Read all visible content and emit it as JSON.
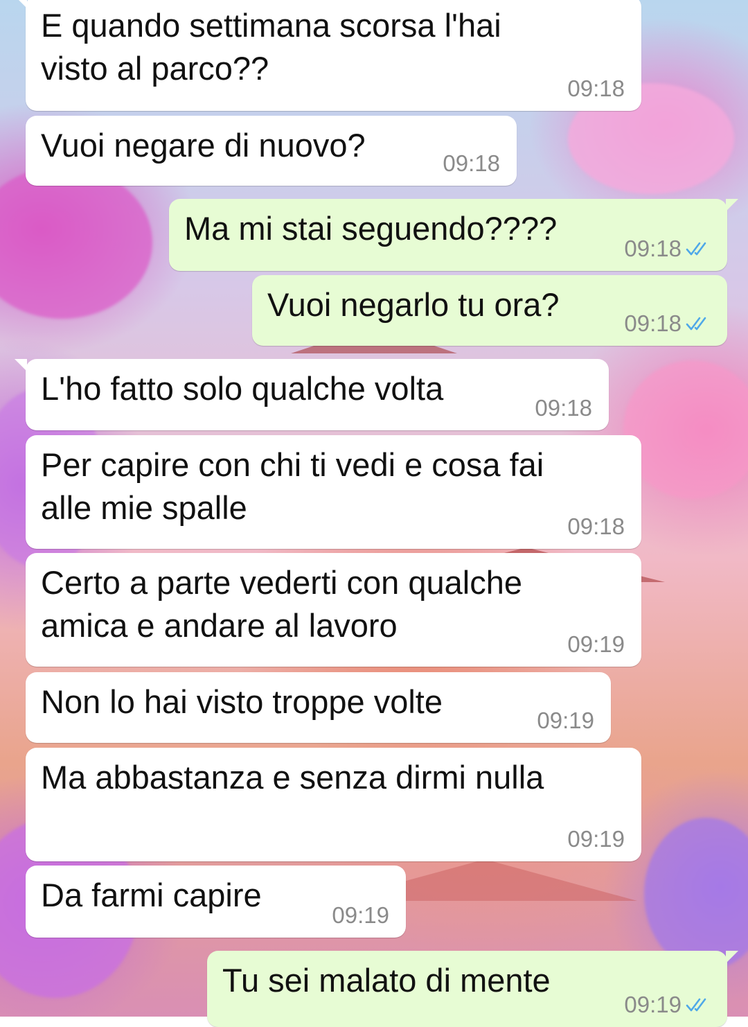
{
  "chat": {
    "messages": [
      {
        "direction": "incoming",
        "text": "E quando settimana scorsa l'hai\nvisto al parco??",
        "time": "09:18"
      },
      {
        "direction": "incoming",
        "text": "Vuoi negare di nuovo?",
        "time": "09:18"
      },
      {
        "direction": "outgoing",
        "text": "Ma mi stai seguendo????",
        "time": "09:18",
        "status": "read-double-check-icon"
      },
      {
        "direction": "outgoing",
        "text": "Vuoi negarlo tu ora?",
        "time": "09:18",
        "status": "read-double-check-icon"
      },
      {
        "direction": "incoming",
        "text": "L'ho fatto solo qualche volta",
        "time": "09:18"
      },
      {
        "direction": "incoming",
        "text": "Per capire con chi ti vedi e cosa fai\nalle mie spalle",
        "time": "09:18"
      },
      {
        "direction": "incoming",
        "text": "Certo a parte vederti con qualche\namica e andare al lavoro",
        "time": "09:19"
      },
      {
        "direction": "incoming",
        "text": "Non lo hai visto troppe volte",
        "time": "09:19"
      },
      {
        "direction": "incoming",
        "text": "Ma abbastanza e senza dirmi nulla",
        "time": "09:19"
      },
      {
        "direction": "incoming",
        "text": "Da farmi capire",
        "time": "09:19"
      },
      {
        "direction": "outgoing",
        "text": "Tu sei malato di mente",
        "time": "09:19",
        "status": "read-double-check-icon"
      }
    ]
  },
  "colors": {
    "incoming_bubble": "#ffffff",
    "outgoing_bubble": "#e7fcd4",
    "timestamp": "#8a8a8a",
    "read_ticks": "#4fa8e8"
  }
}
